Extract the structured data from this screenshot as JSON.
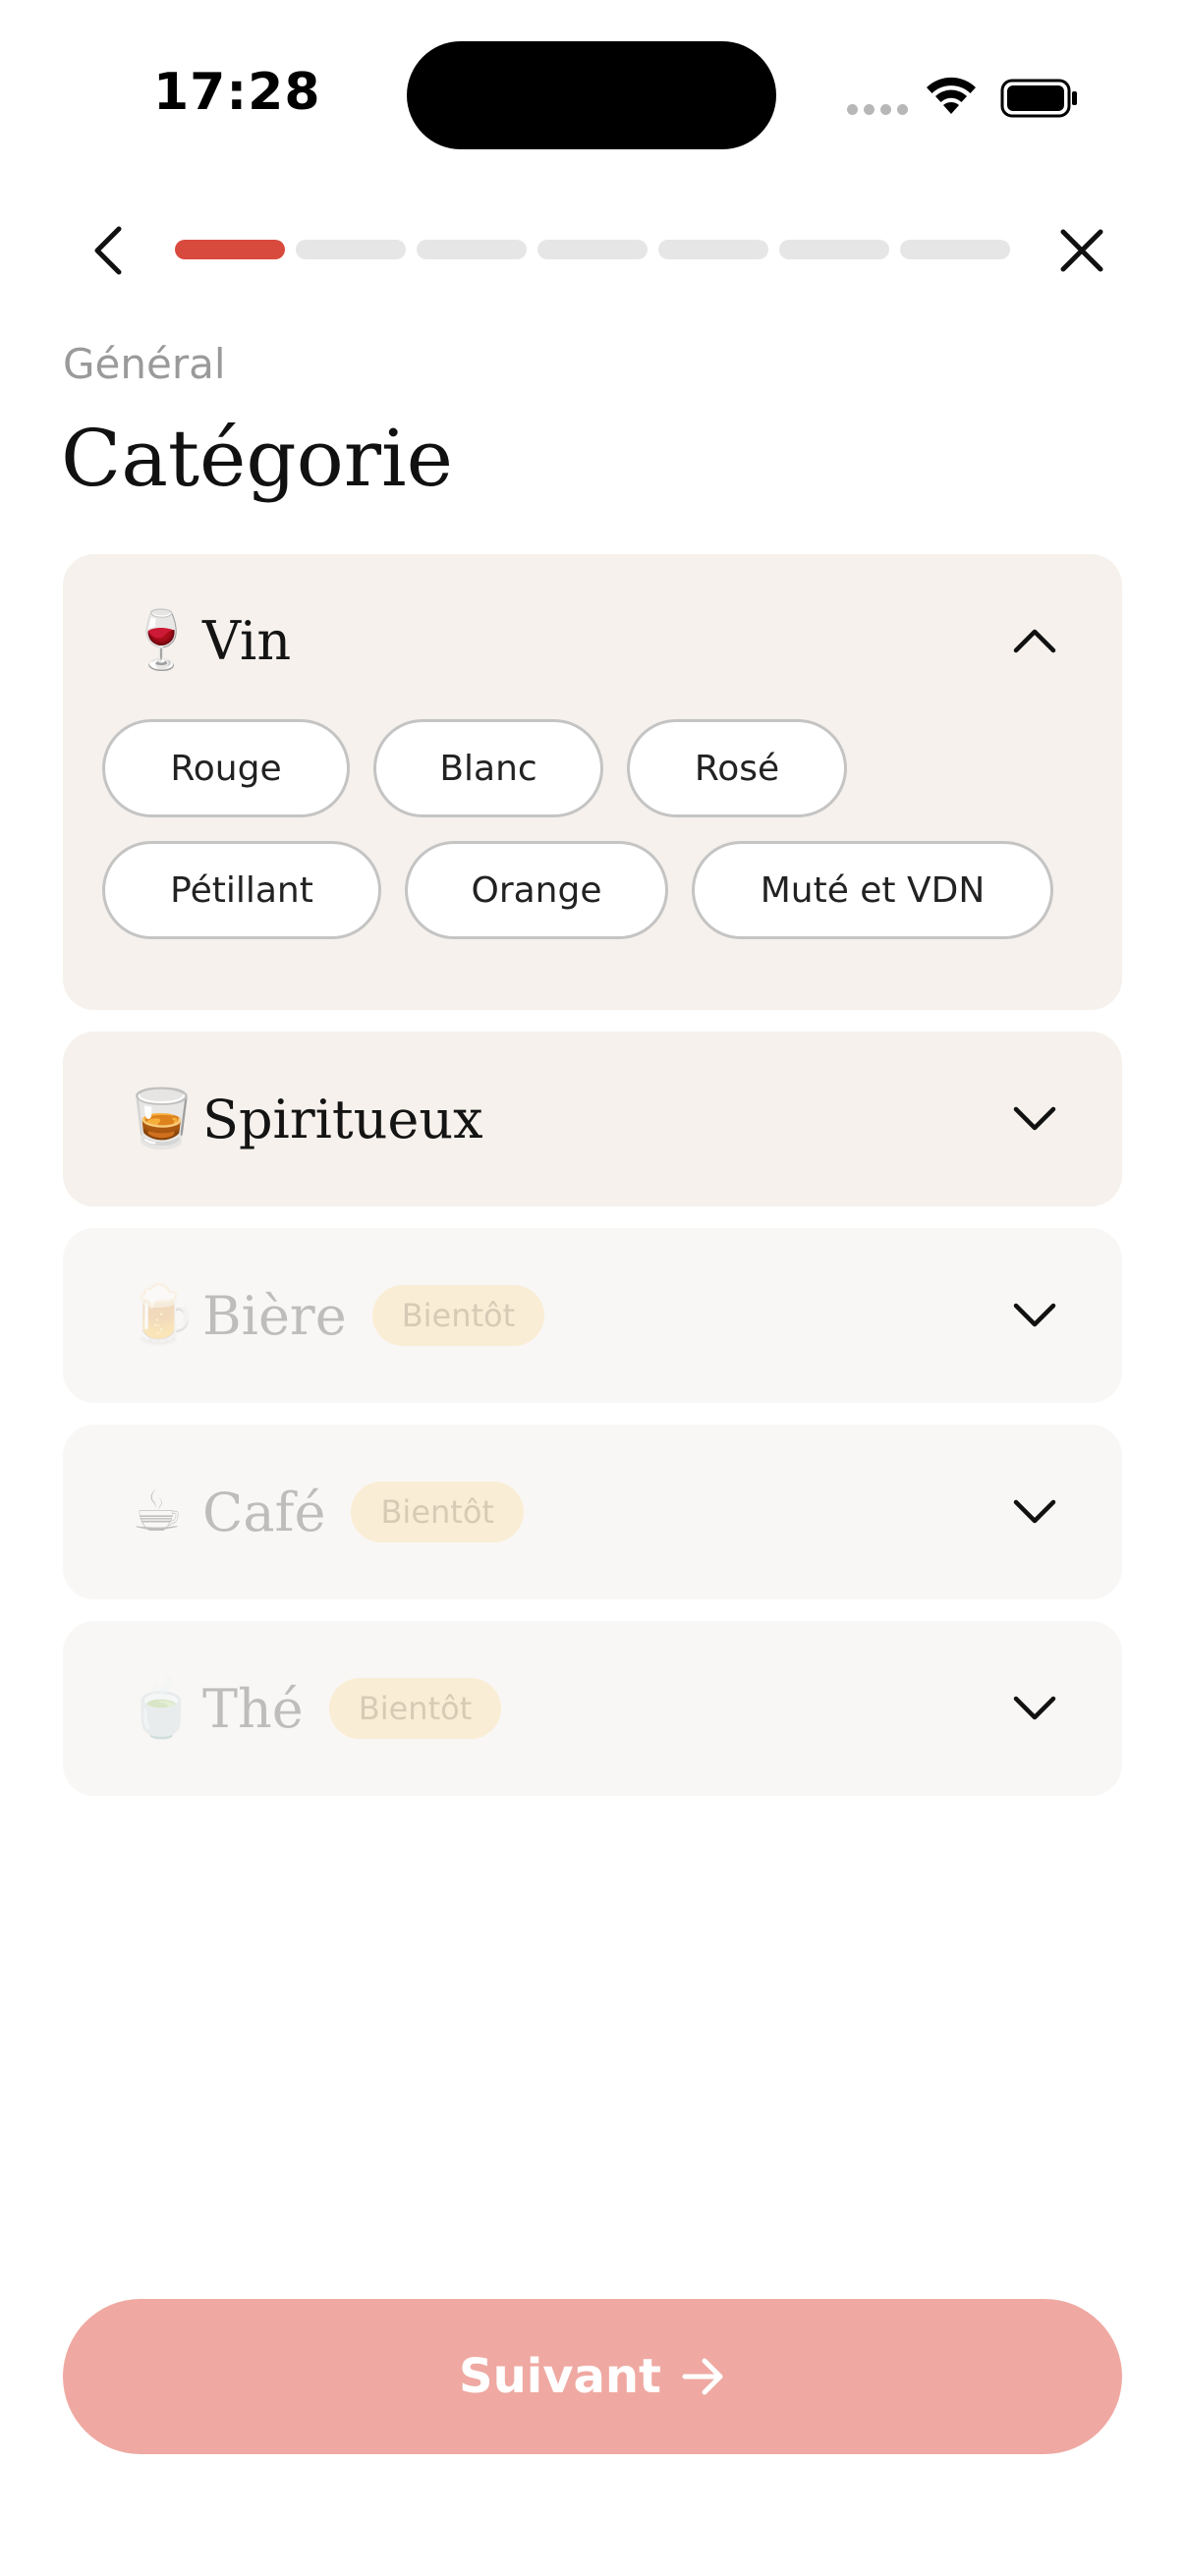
{
  "status_bar": {
    "time": "17:28"
  },
  "header": {
    "section": "Général",
    "title": "Catégorie",
    "progress": {
      "total_steps": 7,
      "current_step": 1
    }
  },
  "categories": [
    {
      "emoji": "🍷",
      "name": "Vin",
      "expanded": true,
      "options": [
        "Rouge",
        "Blanc",
        "Rosé",
        "Pétillant",
        "Orange",
        "Muté et VDN"
      ]
    },
    {
      "emoji": "🥃",
      "name": "Spiritueux",
      "expanded": false
    },
    {
      "emoji": "🍺",
      "name": "Bière",
      "badge": "Bientôt",
      "disabled": true
    },
    {
      "emoji": "☕",
      "name": "Café",
      "badge": "Bientôt",
      "disabled": true
    },
    {
      "emoji": "🍵",
      "name": "Thé",
      "badge": "Bientôt",
      "disabled": true
    }
  ],
  "footer": {
    "next_label": "Suivant"
  },
  "colors": {
    "accent": "#d94a3e",
    "button": "#efa9a2",
    "card": "#f6f1ec",
    "badge": "#faedd5"
  },
  "icons": [
    "back-chevron-icon",
    "close-icon",
    "chevron-up-icon",
    "chevron-down-icon",
    "arrow-right-icon",
    "wifi-icon",
    "battery-icon"
  ]
}
